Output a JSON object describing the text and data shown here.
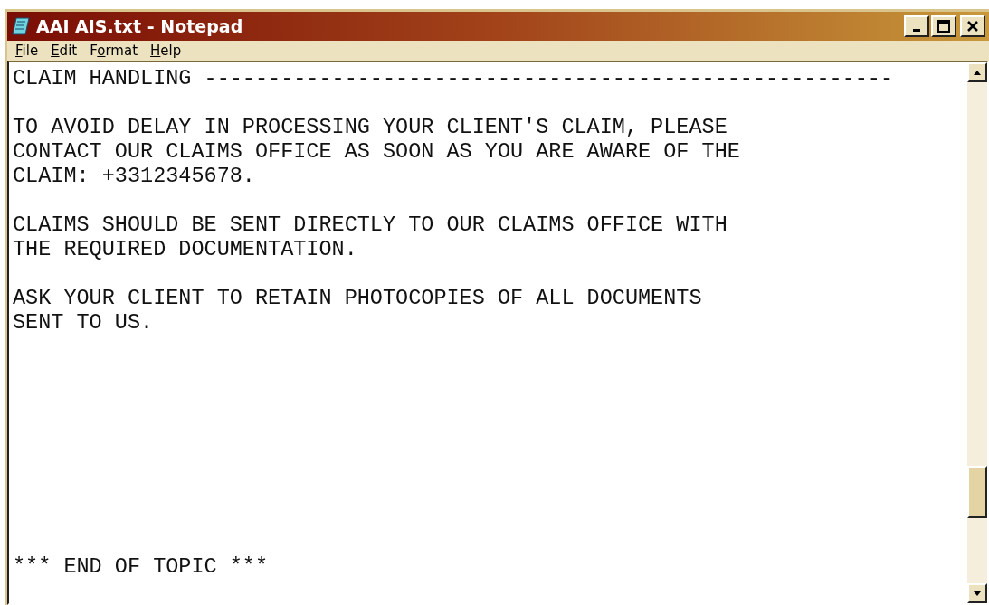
{
  "window": {
    "title": "AAI AIS.txt - Notepad"
  },
  "menu": [
    {
      "label": "File"
    },
    {
      "label": "Edit"
    },
    {
      "label": "Format"
    },
    {
      "label": "Help"
    }
  ],
  "document": {
    "text": "CLAIM HANDLING ------------------------------------------------------\n\nTO AVOID DELAY IN PROCESSING YOUR CLIENT'S CLAIM, PLEASE\nCONTACT OUR CLAIMS OFFICE AS SOON AS YOU ARE AWARE OF THE\nCLAIM: +3312345678.\n\nCLAIMS SHOULD BE SENT DIRECTLY TO OUR CLAIMS OFFICE WITH\nTHE REQUIRED DOCUMENTATION.\n\nASK YOUR CLIENT TO RETAIN PHOTOCOPIES OF ALL DOCUMENTS\nSENT TO US.\n\n\n\n\n\n\n\n\n\n*** END OF TOPIC ***"
  }
}
